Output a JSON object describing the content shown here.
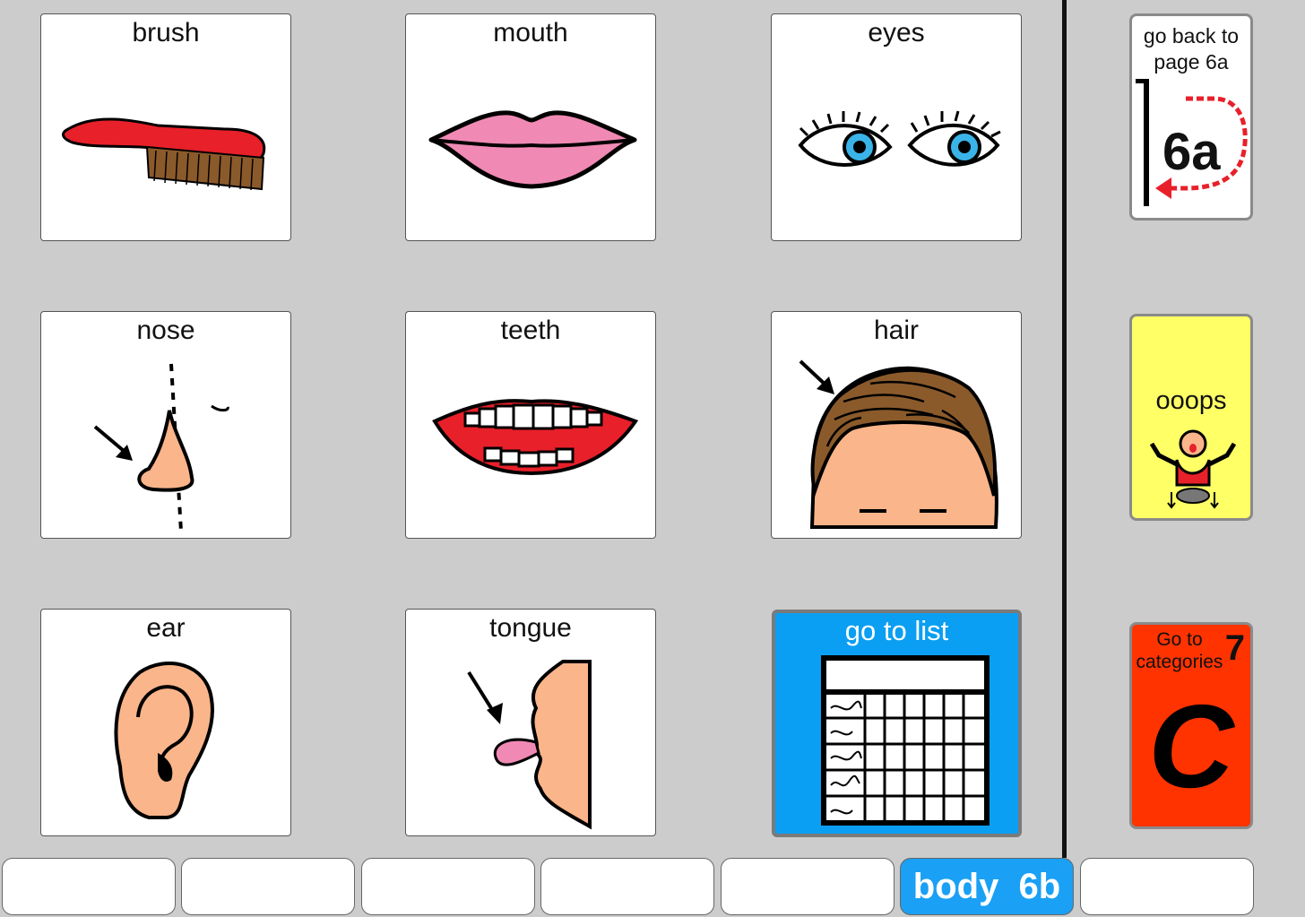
{
  "grid": {
    "cells": [
      {
        "label": "brush",
        "icon": "brush-icon"
      },
      {
        "label": "mouth",
        "icon": "lips-icon"
      },
      {
        "label": "eyes",
        "icon": "eyes-icon"
      },
      {
        "label": "nose",
        "icon": "nose-icon"
      },
      {
        "label": "teeth",
        "icon": "teeth-icon"
      },
      {
        "label": "hair",
        "icon": "hair-icon"
      },
      {
        "label": "ear",
        "icon": "ear-icon"
      },
      {
        "label": "tongue",
        "icon": "tongue-icon"
      }
    ],
    "go_to_list": {
      "label": "go to list",
      "icon": "list-grid-icon"
    }
  },
  "sidebar": {
    "back": {
      "label": "go back to page 6a",
      "page": "6a",
      "icon": "page-back-arrow-icon"
    },
    "oops": {
      "label": "ooops",
      "icon": "person-falling-icon"
    },
    "categories": {
      "label": "Go to categories",
      "number": "7",
      "letter": "C"
    }
  },
  "bottom_bar": {
    "active_label": "body  6b"
  },
  "colors": {
    "background": "#cccccc",
    "accent_blue": "#1aa0f5",
    "oops_yellow": "#ffff66",
    "categories_red": "#ff3300"
  }
}
